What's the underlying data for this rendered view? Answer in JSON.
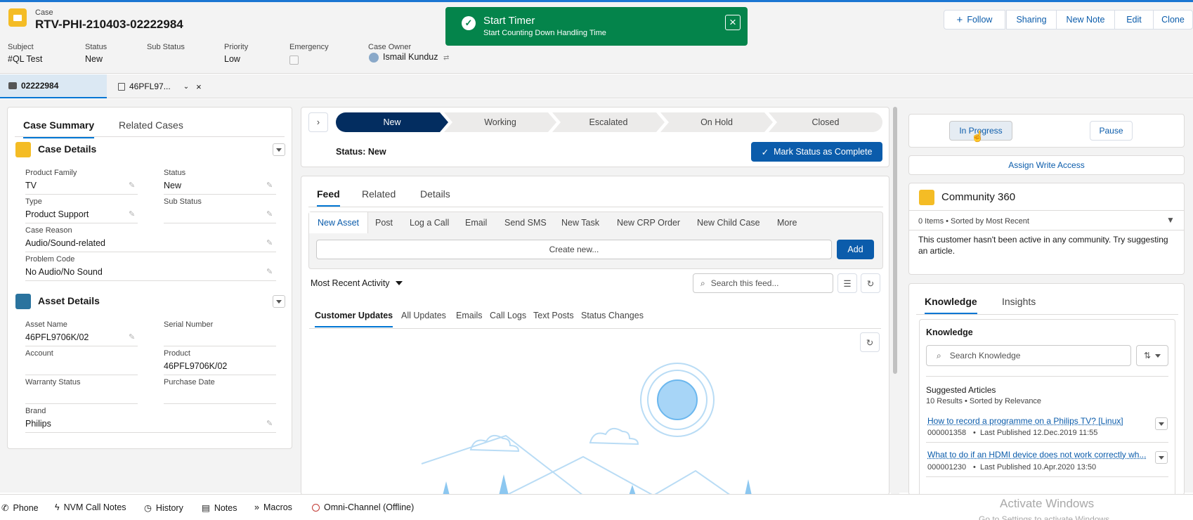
{
  "record": {
    "object_label": "Case",
    "title": "RTV-PHI-210403-02222984",
    "highlights": [
      {
        "label": "Subject",
        "value": "#QL Test"
      },
      {
        "label": "Status",
        "value": "New"
      },
      {
        "label": "Sub Status",
        "value": ""
      },
      {
        "label": "Priority",
        "value": "Low"
      },
      {
        "label": "Emergency",
        "value": ""
      },
      {
        "label": "Case Owner",
        "value": "Ismail Kunduz"
      }
    ],
    "actions": {
      "follow": "Follow",
      "sharing": "Sharing",
      "new_note": "New Note",
      "edit": "Edit",
      "clone": "Clone"
    }
  },
  "toast": {
    "title": "Start Timer",
    "message": "Start Counting Down Handling Time"
  },
  "workspace_tabs": [
    {
      "label": "02222984"
    },
    {
      "label": "46PFL97..."
    }
  ],
  "left": {
    "tabs": [
      "Case Summary",
      "Related Cases"
    ],
    "case_details": {
      "title": "Case Details",
      "fields": [
        {
          "label": "Product Family",
          "value": "TV"
        },
        {
          "label": "Status",
          "value": "New"
        },
        {
          "label": "Type",
          "value": "Product Support"
        },
        {
          "label": "Sub Status",
          "value": ""
        },
        {
          "label": "Case Reason",
          "value": "Audio/Sound-related"
        },
        {
          "label": "Problem Code",
          "value": "No Audio/No Sound"
        }
      ]
    },
    "asset_details": {
      "title": "Asset Details",
      "fields": [
        {
          "label": "Asset Name",
          "value": "46PFL9706K/02"
        },
        {
          "label": "Serial Number",
          "value": ""
        },
        {
          "label": "Account",
          "value": ""
        },
        {
          "label": "Product",
          "value": "46PFL9706K/02"
        },
        {
          "label": "Warranty Status",
          "value": ""
        },
        {
          "label": "Purchase Date",
          "value": ""
        },
        {
          "label": "Brand",
          "value": "Philips"
        }
      ]
    }
  },
  "path": {
    "stages": [
      "New",
      "Working",
      "Escalated",
      "On Hold",
      "Closed"
    ],
    "current": "New",
    "status_text": "Status: New",
    "mark_complete": "Mark Status as Complete"
  },
  "feed": {
    "tabs": [
      "Feed",
      "Related",
      "Details"
    ],
    "publisher_tabs": [
      "New Asset",
      "Post",
      "Log a Call",
      "Email",
      "Send SMS",
      "New Task",
      "New CRP Order",
      "New Child Case",
      "More"
    ],
    "create_placeholder": "Create new...",
    "add_button": "Add",
    "sort_label": "Most Recent Activity",
    "search_placeholder": "Search this feed...",
    "filters": [
      "Customer Updates",
      "All Updates",
      "Emails",
      "Call Logs",
      "Text Posts",
      "Status Changes"
    ]
  },
  "right": {
    "in_progress": "In Progress",
    "pause": "Pause",
    "assign_write_access": "Assign Write Access",
    "community": {
      "title": "Community 360",
      "meta": "0 Items • Sorted by Most Recent",
      "empty_text": "This customer hasn't been active in any community. Try suggesting an article."
    },
    "knowledge": {
      "tabs": [
        "Knowledge",
        "Insights"
      ],
      "heading": "Knowledge",
      "search_placeholder": "Search Knowledge",
      "suggested_title": "Suggested Articles",
      "results_meta": "10 Results • Sorted by Relevance",
      "articles": [
        {
          "title": "How to record a programme on a Philips TV? [Linux]",
          "number": "000001358",
          "published": "Last Published  12.Dec.2019 11:55"
        },
        {
          "title": "What to do if an HDMI device does not work correctly wh...",
          "number": "000001230",
          "published": "Last Published  10.Apr.2020 13:50"
        }
      ]
    }
  },
  "utility_bar": [
    "Phone",
    "NVM Call Notes",
    "History",
    "Notes",
    "Macros",
    "Omni-Channel (Offline)"
  ],
  "watermark": {
    "line1": "Activate Windows",
    "line2": "Go to Settings to activate Windows."
  },
  "colors": {
    "brand": "#0176d3",
    "toast": "#04844b",
    "path_current": "#032d60",
    "case_icon": "#f4bc25",
    "asset_icon": "#2a739e"
  }
}
